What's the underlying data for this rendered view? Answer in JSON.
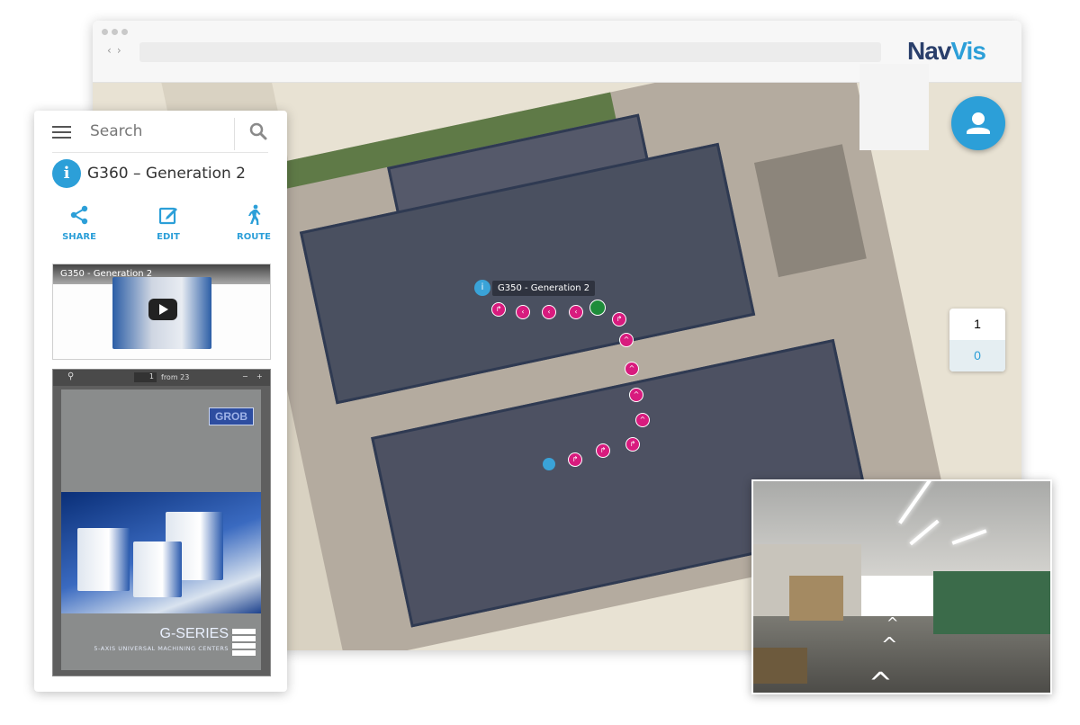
{
  "brand": {
    "logo_nav": "Nav",
    "logo_vis": "Vis",
    "nav_color": "#2a3f6b",
    "vis_color": "#2c9fd8"
  },
  "browser": {
    "back_icon": "chevron-left-icon",
    "forward_icon": "chevron-right-icon"
  },
  "panel": {
    "search_placeholder": "Search",
    "title": "G360 – Generation 2",
    "actions": [
      {
        "label": "SHARE",
        "icon": "share-icon"
      },
      {
        "label": "EDIT",
        "icon": "edit-icon"
      },
      {
        "label": "ROUTE",
        "icon": "walking-person-icon"
      }
    ],
    "video_title": "G350 - Generation 2",
    "pdf": {
      "page_current": "1",
      "page_total_label": "from 23",
      "zoom_out": "−",
      "zoom_in": "+",
      "brand": "GROB",
      "headline": "G-SERIES",
      "subheadline": "5-AXIS UNIVERSAL MACHINING CENTERS"
    }
  },
  "map": {
    "poi_label": "G350 - Generation 2",
    "accent_color": "#d81b7e"
  },
  "floor_selector": {
    "floors": [
      "1",
      "0"
    ],
    "active": "0"
  }
}
